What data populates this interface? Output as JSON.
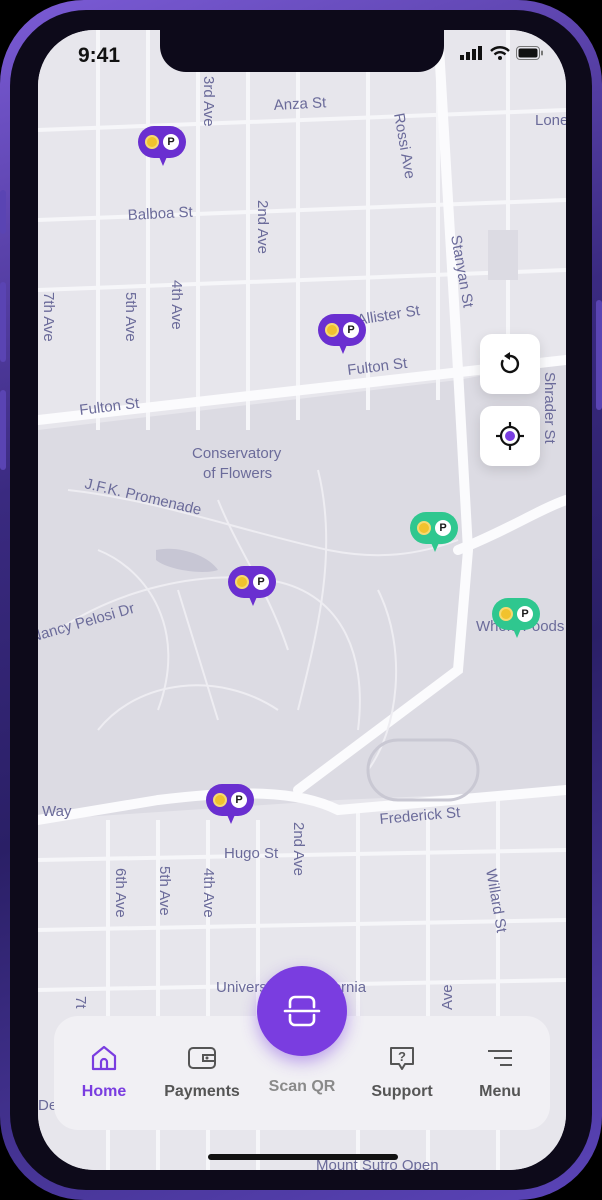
{
  "status_bar": {
    "time": "9:41"
  },
  "map": {
    "streets": [
      "Anza St",
      "Rossi Ave",
      "3rd Ave",
      "Lone",
      "Balboa St",
      "2nd Ave",
      "Stanyan St",
      "7th Ave",
      "5th Ave",
      "4th Ave",
      "McAllister St",
      "Fulton St",
      "Fulton St",
      "Shrader St",
      "Conservatory",
      "of Flowers",
      "J.F.K. Promenade",
      "Nancy Pelosi Dr",
      "Whole Foods",
      "Way",
      "Frederick St",
      "Hugo St",
      "2nd Ave",
      "6th Ave",
      "5th Ave",
      "4th Ave",
      "Willard St",
      "University of California",
      "Ave",
      "7t",
      "De",
      "Mount Sutro Open"
    ],
    "pins": [
      {
        "type": "parking",
        "color": "purple",
        "label": "P"
      },
      {
        "type": "parking",
        "color": "purple",
        "label": "P"
      },
      {
        "type": "parking",
        "color": "purple",
        "label": "P"
      },
      {
        "type": "parking",
        "color": "purple",
        "label": "P"
      },
      {
        "type": "parking",
        "color": "green",
        "label": "P"
      },
      {
        "type": "parking",
        "color": "green",
        "label": "P"
      }
    ]
  },
  "map_controls": {
    "refresh_icon": "refresh-icon",
    "locate_icon": "locate-icon"
  },
  "nav": {
    "home": "Home",
    "payments": "Payments",
    "scan": "Scan QR",
    "support": "Support",
    "menu": "Menu"
  },
  "colors": {
    "accent": "#7a3de0",
    "pin_purple": "#6a2fd0",
    "pin_green": "#2fc78f",
    "map_bg": "#e7e6ec"
  }
}
